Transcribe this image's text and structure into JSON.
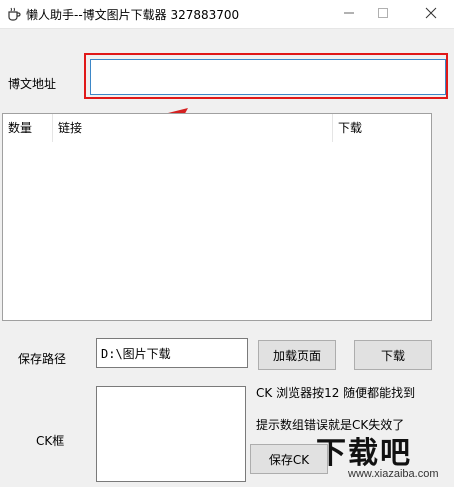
{
  "window": {
    "title": "懒人助手--博文图片下载器  327883700",
    "min_symbol": "—",
    "max_symbol": "☐",
    "close_symbol": "✕"
  },
  "form": {
    "url_label": "博文地址",
    "url_value": "",
    "save_path_label": "保存路径",
    "save_path_value": "D:\\图片下载",
    "ck_label": "CK框",
    "ck_value": ""
  },
  "table": {
    "columns": [
      "数量",
      "链接",
      "下载"
    ],
    "rows": []
  },
  "buttons": {
    "load_page": "加载页面",
    "download": "下载",
    "save_ck": "保存CK"
  },
  "hints": {
    "line1": "CK 浏览器按12 随便都能找到",
    "line2": "提示数组错误就是CK失效了"
  },
  "annotation": {
    "highlight_color": "#e01818",
    "arrow_color": "#d42020"
  },
  "watermark": {
    "main": "下载吧",
    "sub": "www.xiazaiba.com"
  },
  "icons": {
    "app": "coffee-cup-icon",
    "minimize": "minimize-icon",
    "maximize": "maximize-icon",
    "close": "close-icon"
  }
}
